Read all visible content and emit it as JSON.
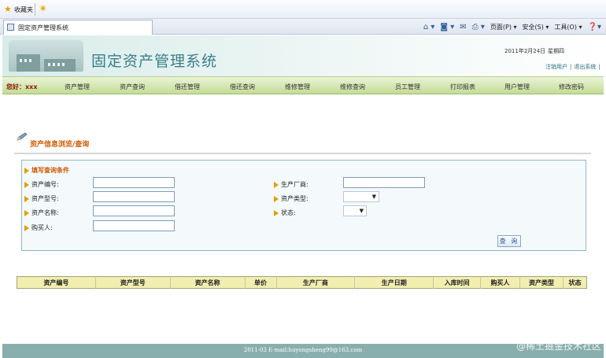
{
  "browser": {
    "favorites_label": "收藏夹",
    "tab_title": "固定资产管理系统",
    "toolbar": {
      "page_menu": "页面(P) ▾",
      "safety_menu": "安全(S) ▾",
      "tools_menu": "工具(O) ▾"
    }
  },
  "header": {
    "system_title": "固定资产管理系统",
    "date": "2011年2月24日",
    "weekday": "星期四",
    "logout_user": "注销用户",
    "separator": "|",
    "exit_system": "退出系统",
    "end_separator": "|"
  },
  "nav": {
    "greeting": "您好：xxx",
    "items": [
      "资产管理",
      "资产查询",
      "借还管理",
      "借还查询",
      "维修管理",
      "维修查询",
      "员工管理",
      "打印报表",
      "用户管理",
      "修改密码"
    ]
  },
  "section": {
    "title": "资产信息浏览/查询"
  },
  "query": {
    "heading": "填写查询条件",
    "fields": {
      "asset_no": {
        "label": "资产编号:",
        "value": ""
      },
      "asset_model": {
        "label": "资产型号:",
        "value": ""
      },
      "asset_name": {
        "label": "资产名称:",
        "value": ""
      },
      "buyer": {
        "label": "购买人:",
        "value": ""
      },
      "manufacturer": {
        "label": "生产厂商:",
        "value": ""
      },
      "asset_type": {
        "label": "资产类型:",
        "value": ""
      },
      "status": {
        "label": "状态:",
        "value": ""
      }
    },
    "search_button": "查 询"
  },
  "table": {
    "columns": [
      "资产编号",
      "资产型号",
      "资产名称",
      "单价",
      "生产厂商",
      "生产日期",
      "入库时间",
      "购买人",
      "资产类型",
      "状态"
    ]
  },
  "footer": {
    "text": "2011-03 E-mail:huyongsheng99@163.com",
    "watermark": "@稀土掘金技术社区"
  }
}
